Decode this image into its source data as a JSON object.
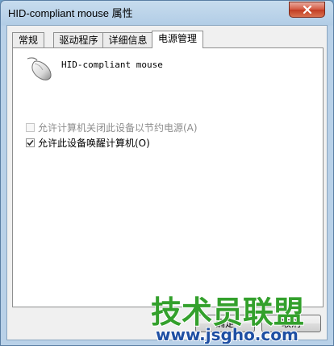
{
  "window": {
    "title": "HID-compliant mouse 属性",
    "close_icon": "close-icon"
  },
  "tabs": [
    {
      "label": "常规",
      "active": false
    },
    {
      "label": "驱动程序",
      "active": false
    },
    {
      "label": "详细信息",
      "active": false
    },
    {
      "label": "电源管理",
      "active": true
    }
  ],
  "device": {
    "name": "HID-compliant mouse",
    "icon": "mouse-icon"
  },
  "options": [
    {
      "label": "允许计算机关闭此设备以节约电源(A)",
      "checked": false,
      "enabled": false
    },
    {
      "label": "允许此设备唤醒计算机(O)",
      "checked": true,
      "enabled": true
    }
  ],
  "buttons": {
    "ok": "确定",
    "cancel": "取消"
  },
  "watermark": {
    "brand": "技术员联盟",
    "url": "www.jsgho.com"
  },
  "colors": {
    "title_bar": "#b9d1e8",
    "close_button": "#c23c22",
    "watermark_green": "#33a02c",
    "watermark_blue": "#1f4fa3"
  }
}
